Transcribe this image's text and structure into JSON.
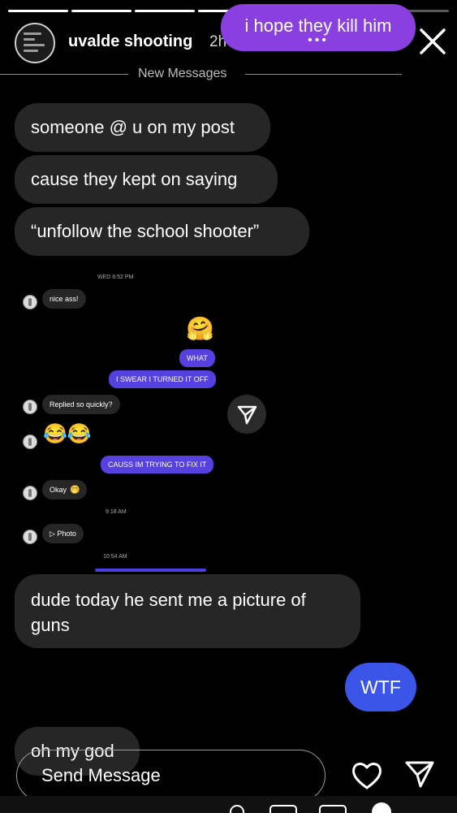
{
  "header": {
    "username": "uvalde shooting",
    "time": "2h"
  },
  "sticker": {
    "text": "i hope they kill him",
    "color": "#8a3fe0"
  },
  "divider": {
    "label": "New Messages"
  },
  "messages": {
    "m1": "someone @ u on my post",
    "m2": "cause they kept on saying",
    "m3": "“unfollow the school shooter”",
    "m4": "dude today he sent me a picture of guns",
    "m5": "WTF",
    "m6": "oh my god"
  },
  "screenshot": {
    "ts1": "WED 8:52 PM",
    "s1": "nice ass!",
    "s2": "WHAT",
    "s3": "I SWEAR I TURNED IT OFF",
    "s4": "Replied so quickly?",
    "s5": "CAUSS IM TRYING TO FIX IT",
    "s6": "Okay",
    "ts2": "9:18 AM",
    "s7": "▷ Photo",
    "ts3": "10:54 AM",
    "emoji_hug": "🤗",
    "emoji_laugh": "😂😂",
    "emoji_small": "🤭"
  },
  "composer": {
    "placeholder": "Send Message"
  },
  "colors": {
    "accent_blue": "#3a55e8",
    "purple": "#5540e0",
    "bubble_gray": "#262626"
  },
  "icons": [
    "close-icon",
    "send-icon",
    "heart-icon",
    "paper-plane-icon"
  ]
}
